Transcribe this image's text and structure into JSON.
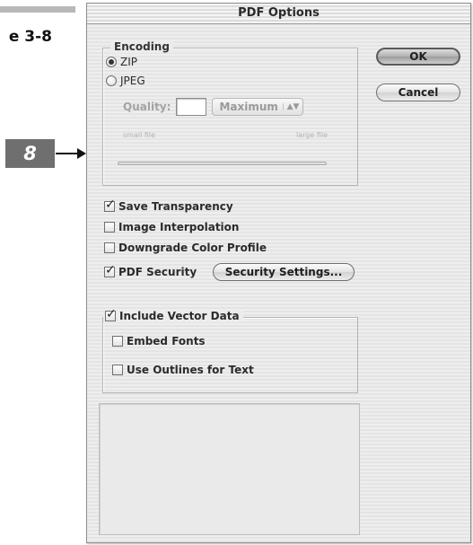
{
  "margin": {
    "figure_label": "e 3-8",
    "callout_number": "8"
  },
  "dialog": {
    "title": "PDF Options",
    "buttons": {
      "ok": "OK",
      "cancel": "Cancel"
    },
    "encoding": {
      "legend": "Encoding",
      "options": [
        {
          "label": "ZIP",
          "selected": true
        },
        {
          "label": "JPEG",
          "selected": false
        }
      ],
      "quality_label": "Quality:",
      "quality_value": "",
      "quality_select": "Maximum",
      "slider_min_label": "small file",
      "slider_max_label": "large file"
    },
    "checkboxes": {
      "save_transparency": {
        "label": "Save Transparency",
        "checked": true
      },
      "image_interpolation": {
        "label": "Image Interpolation",
        "checked": false
      },
      "downgrade_color_profile": {
        "label": "Downgrade Color Profile",
        "checked": false
      },
      "pdf_security": {
        "label": "PDF Security",
        "checked": true
      }
    },
    "security_settings_button": "Security Settings...",
    "vector": {
      "legend": "Include Vector Data",
      "checked": true,
      "embed_fonts": {
        "label": "Embed Fonts",
        "checked": false
      },
      "use_outlines": {
        "label": "Use Outlines for Text",
        "checked": false
      }
    }
  },
  "icons": {
    "check_glyph": "✓",
    "stepper_glyph": "▲▼"
  },
  "colors": {
    "callout_badge": "#6f6f6f",
    "dialog_bg": "#ececec"
  }
}
